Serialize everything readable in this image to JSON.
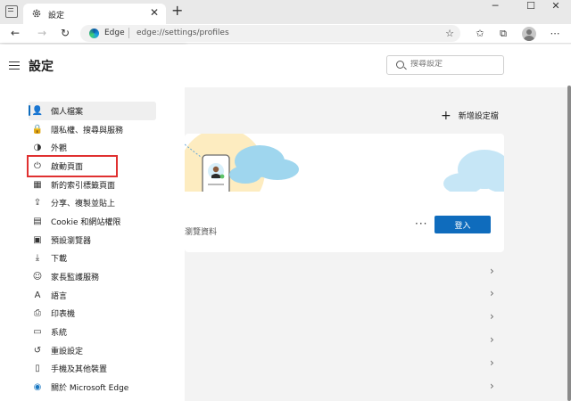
{
  "browser": {
    "tab_title": "設定",
    "tab_close": "✕",
    "new_tab": "+",
    "window_min": "─",
    "window_max": "☐",
    "window_close": "✕",
    "back": "←",
    "forward": "→",
    "refresh": "↻",
    "address_label": "Edge",
    "url": "edge://settings/profiles",
    "more": "⋯"
  },
  "sidebar": {
    "title": "設定",
    "items": [
      {
        "label": "個人檔案",
        "icon": "profile-icon",
        "glyph": "👤"
      },
      {
        "label": "隱私權、搜尋與服務",
        "icon": "lock-icon",
        "glyph": "🔒"
      },
      {
        "label": "外觀",
        "icon": "appearance-icon",
        "glyph": "◑"
      },
      {
        "label": "啟動頁面",
        "icon": "power-icon",
        "glyph": "⏻"
      },
      {
        "label": "新的索引標籤頁面",
        "icon": "new-tab-page-icon",
        "glyph": "▦"
      },
      {
        "label": "分享、複製並貼上",
        "icon": "share-icon",
        "glyph": "⇪"
      },
      {
        "label": "Cookie 和網站權限",
        "icon": "site-permissions-icon",
        "glyph": "▤"
      },
      {
        "label": "預設瀏覽器",
        "icon": "default-browser-icon",
        "glyph": "▣"
      },
      {
        "label": "下載",
        "icon": "download-icon",
        "glyph": "⤓"
      },
      {
        "label": "家長監護服務",
        "icon": "family-icon",
        "glyph": "☺"
      },
      {
        "label": "語言",
        "icon": "language-icon",
        "glyph": "A"
      },
      {
        "label": "印表機",
        "icon": "printer-icon",
        "glyph": "⎙"
      },
      {
        "label": "系統",
        "icon": "system-icon",
        "glyph": "▭"
      },
      {
        "label": "重設設定",
        "icon": "reset-icon",
        "glyph": "↺"
      },
      {
        "label": "手機及其他裝置",
        "icon": "phone-icon",
        "glyph": "▯"
      },
      {
        "label": "關於 Microsoft Edge",
        "icon": "edge-logo-icon",
        "glyph": "◉"
      }
    ]
  },
  "main": {
    "search_placeholder": "搜尋設定",
    "add_profile": "新增設定檔",
    "card_text": "瀏覽資料",
    "card_more": "···",
    "sign_in": "登入"
  },
  "colors": {
    "accent": "#0f6cbd",
    "highlight_box": "#e03131",
    "cloud": "#9fd6ee",
    "sun": "#fde9b4"
  }
}
